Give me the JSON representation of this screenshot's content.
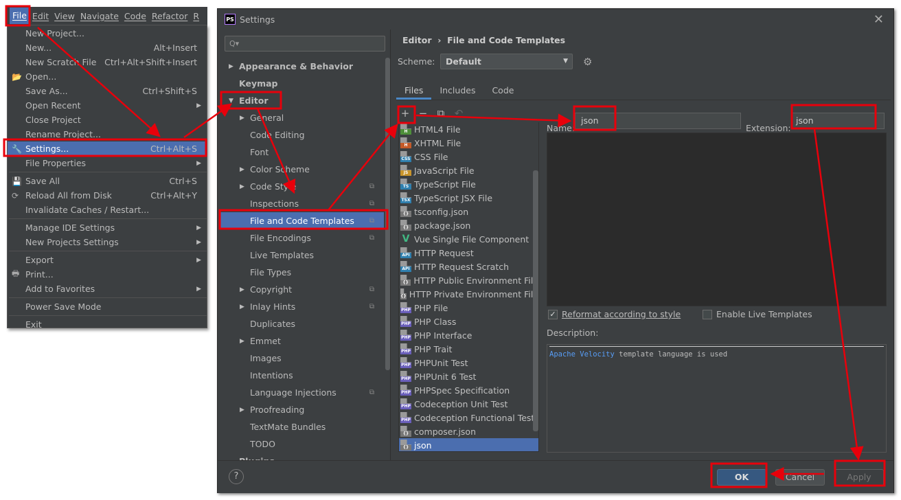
{
  "menubar": [
    "File",
    "Edit",
    "View",
    "Navigate",
    "Code",
    "Refactor",
    "R"
  ],
  "file_menu": [
    {
      "label": "New Project..."
    },
    {
      "label": "New...",
      "shortcut": "Alt+Insert"
    },
    {
      "label": "New Scratch File",
      "shortcut": "Ctrl+Alt+Shift+Insert"
    },
    {
      "label": "Open...",
      "icon": "folder-icon"
    },
    {
      "label": "Save As...",
      "shortcut": "Ctrl+Shift+S"
    },
    {
      "label": "Open Recent",
      "submenu": true
    },
    {
      "label": "Close Project"
    },
    {
      "label": "Rename Project..."
    },
    {
      "label": "Settings...",
      "shortcut": "Ctrl+Alt+S",
      "icon": "wrench-icon",
      "selected": true
    },
    {
      "label": "File Properties",
      "submenu": true
    },
    {
      "sep": true
    },
    {
      "label": "Save All",
      "shortcut": "Ctrl+S",
      "icon": "save-icon"
    },
    {
      "label": "Reload All from Disk",
      "shortcut": "Ctrl+Alt+Y",
      "icon": "reload-icon"
    },
    {
      "label": "Invalidate Caches / Restart..."
    },
    {
      "sep": true
    },
    {
      "label": "Manage IDE Settings",
      "submenu": true
    },
    {
      "label": "New Projects Settings",
      "submenu": true
    },
    {
      "sep": true
    },
    {
      "label": "Export",
      "submenu": true
    },
    {
      "label": "Print...",
      "icon": "print-icon"
    },
    {
      "label": "Add to Favorites",
      "submenu": true
    },
    {
      "sep": true
    },
    {
      "label": "Power Save Mode"
    },
    {
      "sep": true
    },
    {
      "label": "Exit"
    }
  ],
  "dialog": {
    "title": "Settings",
    "logo": "PS",
    "search_placeholder": "Q▾",
    "tree": [
      {
        "label": "Appearance & Behavior",
        "level": 0,
        "arrow": "right",
        "bold": true
      },
      {
        "label": "Keymap",
        "level": 0,
        "bold": true
      },
      {
        "label": "Editor",
        "level": 0,
        "arrow": "down",
        "bold": true
      },
      {
        "label": "General",
        "level": 1,
        "arrow": "right"
      },
      {
        "label": "Code Editing",
        "level": 1
      },
      {
        "label": "Font",
        "level": 1
      },
      {
        "label": "Color Scheme",
        "level": 1,
        "arrow": "right"
      },
      {
        "label": "Code Style",
        "level": 1,
        "arrow": "right",
        "copy": true
      },
      {
        "label": "Inspections",
        "level": 1,
        "copy": true
      },
      {
        "label": "File and Code Templates",
        "level": 1,
        "copy": true,
        "selected": true
      },
      {
        "label": "File Encodings",
        "level": 1,
        "copy": true
      },
      {
        "label": "Live Templates",
        "level": 1
      },
      {
        "label": "File Types",
        "level": 1
      },
      {
        "label": "Copyright",
        "level": 1,
        "arrow": "right",
        "copy": true
      },
      {
        "label": "Inlay Hints",
        "level": 1,
        "arrow": "right",
        "copy": true
      },
      {
        "label": "Duplicates",
        "level": 1
      },
      {
        "label": "Emmet",
        "level": 1,
        "arrow": "right"
      },
      {
        "label": "Images",
        "level": 1
      },
      {
        "label": "Intentions",
        "level": 1
      },
      {
        "label": "Language Injections",
        "level": 1,
        "copy": true
      },
      {
        "label": "Proofreading",
        "level": 1,
        "arrow": "right"
      },
      {
        "label": "TextMate Bundles",
        "level": 1
      },
      {
        "label": "TODO",
        "level": 1
      },
      {
        "label": "Plugins",
        "level": 0,
        "bold": true
      }
    ],
    "breadcrumb": [
      "Editor",
      "File and Code Templates"
    ],
    "scheme_label": "Scheme:",
    "scheme_value": "Default",
    "tabs": [
      "Files",
      "Includes",
      "Code"
    ],
    "active_tab": "Files",
    "toolbar": [
      "+",
      "−",
      "⧉",
      "↶"
    ],
    "templates": [
      {
        "label": "HTML4 File",
        "badge": "H",
        "color": "#4e8f3a"
      },
      {
        "label": "XHTML File",
        "badge": "H",
        "color": "#c45a28"
      },
      {
        "label": "CSS File",
        "badge": "CSS",
        "color": "#2f7fae"
      },
      {
        "label": "JavaScript File",
        "badge": "JS",
        "color": "#c9952b"
      },
      {
        "label": "TypeScript File",
        "badge": "TS",
        "color": "#2f7fae"
      },
      {
        "label": "TypeScript JSX File",
        "badge": "TSX",
        "color": "#2f7fae"
      },
      {
        "label": "tsconfig.json",
        "badge": "{}",
        "color": "#777"
      },
      {
        "label": "package.json",
        "badge": "{}",
        "color": "#777"
      },
      {
        "label": "Vue Single File Component",
        "badge": "V",
        "color": "#41b883"
      },
      {
        "label": "HTTP Request",
        "badge": "API",
        "color": "#2f7fae"
      },
      {
        "label": "HTTP Request Scratch",
        "badge": "API",
        "color": "#2f7fae"
      },
      {
        "label": "HTTP Public Environment File",
        "badge": "{}",
        "color": "#777"
      },
      {
        "label": "HTTP Private Environment File",
        "badge": "{}",
        "color": "#777"
      },
      {
        "label": "PHP File",
        "badge": "PHP",
        "color": "#6a5fbb"
      },
      {
        "label": "PHP Class",
        "badge": "PHP",
        "color": "#6a5fbb"
      },
      {
        "label": "PHP Interface",
        "badge": "PHP",
        "color": "#6a5fbb"
      },
      {
        "label": "PHP Trait",
        "badge": "PHP",
        "color": "#6a5fbb"
      },
      {
        "label": "PHPUnit Test",
        "badge": "PHP",
        "color": "#6a5fbb"
      },
      {
        "label": "PHPUnit 6 Test",
        "badge": "PHP",
        "color": "#6a5fbb"
      },
      {
        "label": "PHPSpec Specification",
        "badge": "PHP",
        "color": "#6a5fbb"
      },
      {
        "label": "Codeception Unit Test",
        "badge": "PHP",
        "color": "#6a5fbb"
      },
      {
        "label": "Codeception Functional Test",
        "badge": "PHP",
        "color": "#6a5fbb"
      },
      {
        "label": "composer.json",
        "badge": "{}",
        "color": "#777"
      },
      {
        "label": "json",
        "badge": "{}",
        "color": "#777",
        "selected": true
      }
    ],
    "name_label": "Name:",
    "name_value": "json",
    "ext_label": "Extension:",
    "ext_value": "json",
    "reformat_label": "Reformat according to style",
    "reformat_checked": true,
    "live_label": "Enable Live Templates",
    "live_checked": false,
    "desc_label": "Description:",
    "desc_link": "Apache Velocity",
    "desc_text": " template language is used",
    "help": "?",
    "ok": "OK",
    "cancel": "Cancel",
    "apply": "Apply"
  },
  "annotation_color": "#e8000b"
}
